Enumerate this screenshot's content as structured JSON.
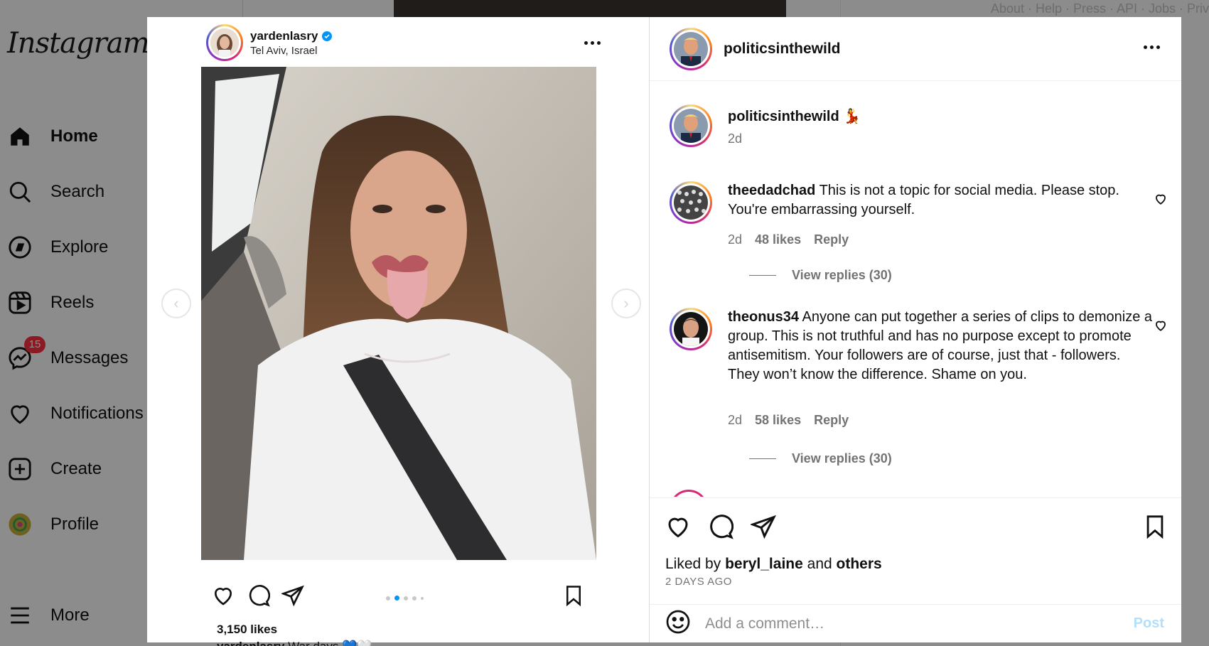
{
  "nav": {
    "logo": "Instagram",
    "items": [
      {
        "label": "Home",
        "icon": "home-icon"
      },
      {
        "label": "Search",
        "icon": "search-icon"
      },
      {
        "label": "Explore",
        "icon": "compass-icon"
      },
      {
        "label": "Reels",
        "icon": "reels-icon"
      },
      {
        "label": "Messages",
        "icon": "messenger-icon",
        "badge": "15"
      },
      {
        "label": "Notifications",
        "icon": "heart-icon"
      },
      {
        "label": "Create",
        "icon": "plus-square-icon"
      },
      {
        "label": "Profile",
        "icon": "profile-avatar-icon"
      },
      {
        "label": "More",
        "icon": "hamburger-icon"
      }
    ]
  },
  "footer": {
    "links": "About · Help · Press · API · Jobs · Priv"
  },
  "post": {
    "username": "yardenlasry",
    "location": "Tel Aviv, Israel",
    "likes": "3,150 likes",
    "caption_user": "yardenlasry",
    "caption_text": "War days 💙🤍"
  },
  "detail": {
    "username": "politicsinthewild",
    "owner_line": {
      "username": "politicsinthewild",
      "emoji": "💃",
      "time": "2d"
    },
    "comments": [
      {
        "username": "theedadchad",
        "text": "This is not a topic for social media. Please stop. You're embarrassing yourself.",
        "time": "2d",
        "likes": "48 likes",
        "reply": "Reply",
        "view_replies": "View replies (30)"
      },
      {
        "username": "theonus34",
        "text": "Anyone can put together a series of clips to demonize a group. This is not truthful and has no purpose except to promote antisemitism. Your followers are of course, just that - followers. They won’t know the difference. Shame on you.",
        "time": "2d",
        "likes": "58 likes",
        "reply": "Reply",
        "view_replies": "View replies (30)"
      }
    ],
    "liked_by_prefix": "Liked by",
    "liked_by_user": "beryl_laine",
    "liked_by_and": "and",
    "liked_by_others": "others",
    "time_ago": "2 DAYS AGO",
    "comment_placeholder": "Add a comment…",
    "post_button": "Post"
  },
  "colors": {
    "accent": "#0095f6",
    "badge": "#ff3040",
    "post_disabled": "#b2dffc"
  }
}
